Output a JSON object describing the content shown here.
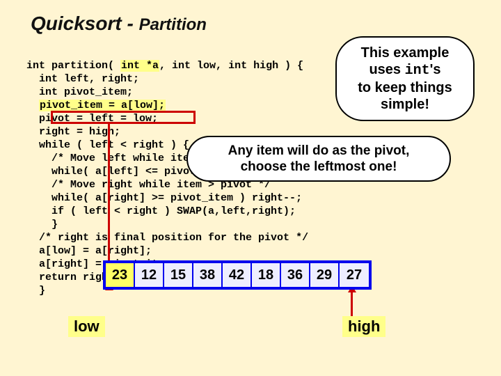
{
  "title_main": "Quicksort - ",
  "title_sub": "Partition",
  "code": {
    "l1a": "int partition( ",
    "l1_hl": "int *a",
    "l1b": ", int low, int high ) {",
    "l2": "  int left, right;",
    "l3": "  int pivot_item;",
    "l4a": "  ",
    "l4_hl": "pivot_item = a[low];",
    "l5": "  pivot = left = low;",
    "l6": "  right = high;",
    "l7": "  while ( left < right ) {",
    "l8": "    /* Move left while item < pivot */",
    "l9": "    while( a[left] <= pivot_item ) left++;",
    "l10": "    /* Move right while item > pivot */",
    "l11": "    while( a[right] >= pivot_item ) right--;",
    "l12": "    if ( left < right ) SWAP(a,left,right);",
    "l13": "    }",
    "l14": "  /* right is final position for the pivot */",
    "l15": "  a[low] = a[right];",
    "l16": "  a[right] = pivot_item;",
    "l17": "  return right;",
    "l18": "  }"
  },
  "callout1_line1": "This example",
  "callout1_line2a": "uses ",
  "callout1_line2b": "int",
  "callout1_line2c": "'s",
  "callout1_line3": "to keep things",
  "callout1_line4": "simple!",
  "callout2_line1": "Any item will do as the pivot,",
  "callout2_line2": "choose the leftmost one!",
  "array": [
    "23",
    "12",
    "15",
    "38",
    "42",
    "18",
    "36",
    "29",
    "27"
  ],
  "label_low": "low",
  "label_high": "high"
}
